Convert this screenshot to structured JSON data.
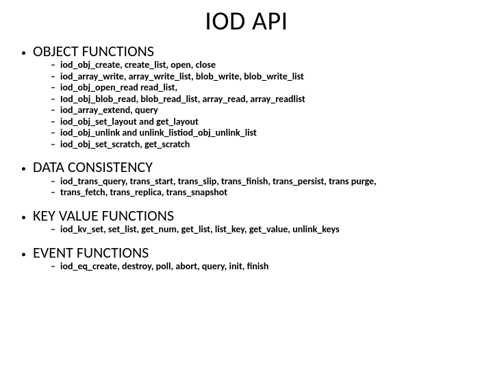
{
  "title": "IOD API",
  "sections": [
    {
      "heading": "OBJECT FUNCTIONS",
      "items": [
        "iod_obj_create, create_list, open, close",
        "iod_array_write, array_write_list, blob_write, blob_write_list",
        "iod_obj_open_read read_list,",
        "Iod_obj_blob_read, blob_read_list, array_read, array_readlist",
        "iod_array_extend, query",
        "iod_obj_set_layout and get_layout",
        "iod_obj_unlink and unlink_listiod_obj_unlink_list",
        "iod_obj_set_scratch, get_scratch"
      ]
    },
    {
      "heading": "DATA CONSISTENCY",
      "items": [
        "iod_trans_query, trans_start, trans_slip, trans_finish, trans_persist, trans purge,",
        "trans_fetch, trans_replica, trans_snapshot"
      ]
    },
    {
      "heading": "KEY VALUE FUNCTIONS",
      "items": [
        "iod_kv_set, set_list, get_num, get_list, list_key, get_value, unlink_keys"
      ]
    },
    {
      "heading": "EVENT FUNCTIONS",
      "items": [
        "iod_eq_create, destroy, poll, abort, query, init, finish"
      ]
    }
  ]
}
